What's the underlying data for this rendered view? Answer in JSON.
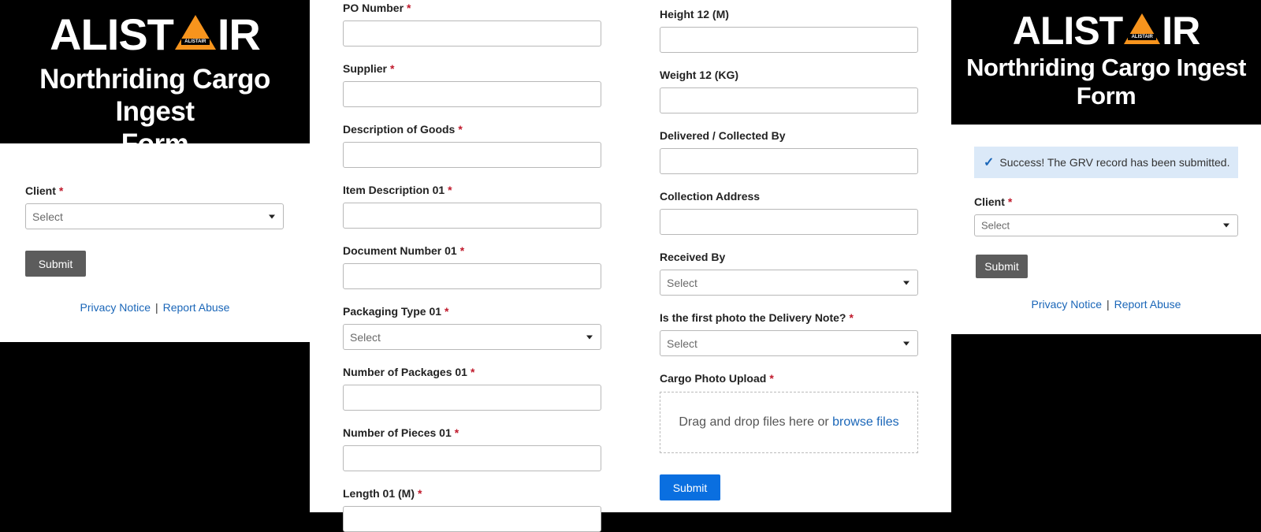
{
  "panel1": {
    "logo": {
      "pre": "ALIST",
      "post": "IR",
      "mini": "ALISTAIR"
    },
    "title_line1": "Northriding Cargo Ingest",
    "title_line2": "Form",
    "client_label": "Client",
    "client_value": "Select",
    "submit_label": "Submit",
    "privacy_link": "Privacy Notice",
    "separator": "|",
    "report_link": "Report Abuse"
  },
  "panel2": {
    "fields": [
      {
        "label": "PO Number",
        "required": true,
        "type": "input"
      },
      {
        "label": "Supplier",
        "required": true,
        "type": "input"
      },
      {
        "label": "Description of Goods",
        "required": true,
        "type": "input"
      },
      {
        "label": "Item Description 01",
        "required": true,
        "type": "input"
      },
      {
        "label": "Document Number 01",
        "required": true,
        "type": "input"
      },
      {
        "label": "Packaging Type 01",
        "required": true,
        "type": "select",
        "value": "Select"
      },
      {
        "label": "Number of Packages 01",
        "required": true,
        "type": "input"
      },
      {
        "label": "Number of Pieces 01",
        "required": true,
        "type": "input"
      },
      {
        "label": "Length 01 (M)",
        "required": true,
        "type": "input"
      }
    ]
  },
  "panel3": {
    "fields": [
      {
        "label": "Height 12 (M)",
        "required": false,
        "type": "input"
      },
      {
        "label": "Weight 12 (KG)",
        "required": false,
        "type": "input"
      },
      {
        "label": "Delivered / Collected By",
        "required": false,
        "type": "input"
      },
      {
        "label": "Collection Address",
        "required": false,
        "type": "input"
      },
      {
        "label": "Received By",
        "required": false,
        "type": "select",
        "value": "Select"
      },
      {
        "label": "Is the first photo the Delivery Note?",
        "required": true,
        "type": "select",
        "value": "Select"
      }
    ],
    "upload_label": "Cargo Photo Upload",
    "upload_text": "Drag and drop files here or",
    "upload_link": "browse files",
    "submit_label": "Submit",
    "submit_color": "#0a6fe0"
  },
  "panel4": {
    "logo": {
      "pre": "ALIST",
      "post": "IR",
      "mini": "ALISTAIR"
    },
    "title_line1": "Northriding Cargo Ingest",
    "title_line2": "Form",
    "success_message": "Success! The GRV record has been submitted.",
    "client_label": "Client",
    "client_value": "Select",
    "submit_label": "Submit",
    "privacy_link": "Privacy Notice",
    "separator": "|",
    "report_link": "Report Abuse"
  },
  "colors": {
    "required": "#c0192b",
    "link": "#1a66b8",
    "logo_triangle": "#f7941d",
    "success_bg": "#dbe9f8",
    "gray_button": "#5c5c5c"
  },
  "required_mark": "*"
}
